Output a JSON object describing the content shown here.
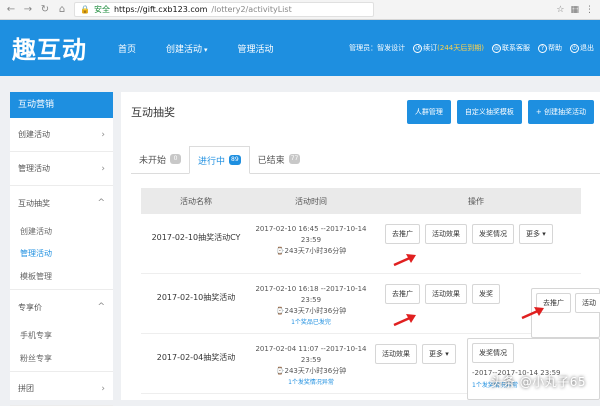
{
  "browser": {
    "back_icon": "arrow-left-icon",
    "forward_icon": "arrow-right-icon",
    "reload_icon": "reload-icon",
    "home_icon": "home-icon",
    "lock_label": "安全",
    "url_host": "https://gift.cxb123.com",
    "url_path": "/lottery2/activityList"
  },
  "app": {
    "logo_text": "趣互动",
    "nav": [
      "首页",
      "创建活动",
      "管理活动"
    ],
    "user_name": "管理员：智发设计",
    "renew_label": "续订",
    "renew_count": "(244天后到期)",
    "contact_label": "联系客服",
    "help_label": "帮助",
    "logout_label": "退出"
  },
  "sidebar": {
    "header": "互动营销",
    "items": [
      {
        "label": "创建活动",
        "chev": "›"
      },
      {
        "label": "管理活动",
        "chev": "›"
      },
      {
        "label": "互动抽奖",
        "chev": "^"
      }
    ],
    "sub_items": [
      "创建活动",
      "管理活动",
      "模板管理"
    ],
    "items2": [
      {
        "label": "专享价",
        "chev": "^"
      }
    ],
    "sub_items2": [
      "手机专享",
      "粉丝专享"
    ],
    "items3": [
      {
        "label": "拼团",
        "chev": "›"
      }
    ]
  },
  "main": {
    "title": "互动抽奖",
    "buttons": [
      "人群管理",
      "自定义抽奖模板",
      "+ 创建抽奖活动"
    ],
    "tabs": [
      {
        "label": "未开始",
        "count": "0"
      },
      {
        "label": "进行中",
        "count": "89"
      },
      {
        "label": "已结束",
        "count": "77"
      }
    ],
    "columns": [
      "活动名称",
      "活动时间",
      "操作"
    ],
    "rows": [
      {
        "name": "2017-02-10抽奖活动CY",
        "time": "2017-02-10 16:45 --2017-10-14 23:59",
        "remain": "⌚243天7小时36分钟",
        "link": "",
        "ops": [
          "去推广",
          "活动效果",
          "发奖情况",
          "更多 ▾"
        ]
      },
      {
        "name": "2017-02-10抽奖活动",
        "time": "2017-02-10 16:18 --2017-10-14 23:59",
        "remain": "⌚243天7小时36分钟",
        "link": "1个奖品已发完",
        "ops": [
          "去推广",
          "活动效果",
          "发奖"
        ]
      },
      {
        "name": "2017-02-04抽奖活动",
        "time": "2017-02-04 11:07 --2017-10-14 23:59",
        "remain": "⌚243天7小时36分钟",
        "link": "1个发奖情况异常",
        "ops": [
          "活动效果",
          "更多 ▾"
        ]
      }
    ],
    "overlay_ops": [
      "去推广",
      "活动"
    ],
    "overlay_report": "发奖情况",
    "overlay_time": "-2017--2017-10-14 23:59",
    "overlay_link": "1个发奖情况异常"
  },
  "watermark": "头条 @小丸子65",
  "colors": {
    "brand": "#1e8fe0",
    "arrow": "#e02020"
  }
}
